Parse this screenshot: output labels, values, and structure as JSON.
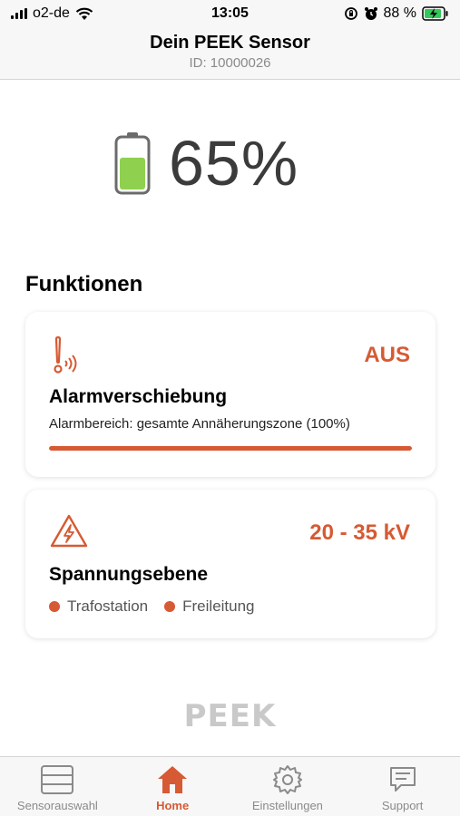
{
  "status_bar": {
    "carrier": "o2-de",
    "time": "13:05",
    "battery_percent": "88 %"
  },
  "header": {
    "title": "Dein PEEK Sensor",
    "subtitle": "ID: 10000026"
  },
  "battery": {
    "percent_label": "65%",
    "level": 0.65,
    "fill_color": "#8fd14f"
  },
  "functions": {
    "section_title": "Funktionen",
    "alarm": {
      "icon": "alarm-signal-icon",
      "value": "AUS",
      "title": "Alarmverschiebung",
      "description": "Alarmbereich: gesamte Annäherungszone (100%)",
      "progress": 1.0
    },
    "voltage": {
      "icon": "high-voltage-icon",
      "value": "20 - 35 kV",
      "title": "Spannungsebene",
      "tags": [
        "Trafostation",
        "Freileitung"
      ]
    }
  },
  "logo": "PEEK",
  "colors": {
    "accent": "#d65a33",
    "battery_fill": "#8fd14f"
  },
  "tabbar": {
    "items": [
      {
        "label": "Sensorauswahl",
        "icon": "sensor-list-icon",
        "active": false
      },
      {
        "label": "Home",
        "icon": "home-icon",
        "active": true
      },
      {
        "label": "Einstellungen",
        "icon": "gear-icon",
        "active": false
      },
      {
        "label": "Support",
        "icon": "chat-icon",
        "active": false
      }
    ]
  }
}
